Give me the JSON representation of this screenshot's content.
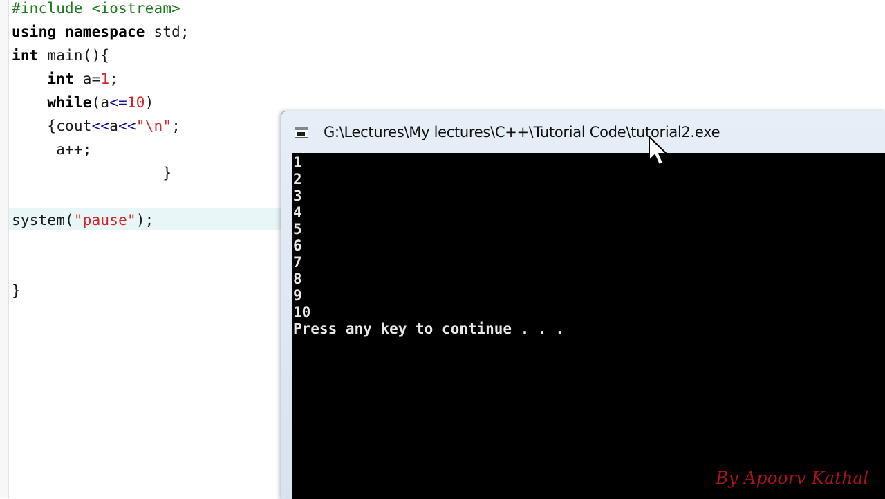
{
  "editor": {
    "lines": [
      [
        {
          "t": "#include <iostream>",
          "c": "pp"
        }
      ],
      [
        {
          "t": "using",
          "c": "kw"
        },
        {
          "t": " "
        },
        {
          "t": "namespace",
          "c": "kw"
        },
        {
          "t": " std;"
        }
      ],
      [
        {
          "t": "int",
          "c": "kw"
        },
        {
          "t": " main(){"
        }
      ],
      [
        {
          "t": "    "
        },
        {
          "t": "int",
          "c": "kw"
        },
        {
          "t": " a="
        },
        {
          "t": "1",
          "c": "num"
        },
        {
          "t": ";"
        }
      ],
      [
        {
          "t": "    "
        },
        {
          "t": "while",
          "c": "kw"
        },
        {
          "t": "(a"
        },
        {
          "t": "<=",
          "c": "op"
        },
        {
          "t": "10",
          "c": "num"
        },
        {
          "t": ")"
        }
      ],
      [
        {
          "t": "    {cout"
        },
        {
          "t": "<<",
          "c": "op"
        },
        {
          "t": "a"
        },
        {
          "t": "<<",
          "c": "op"
        },
        {
          "t": "\"\\n\"",
          "c": "str"
        },
        {
          "t": ";"
        }
      ],
      [
        {
          "t": "     a++;"
        }
      ],
      [
        {
          "t": "                 }"
        }
      ],
      [
        {
          "t": ""
        }
      ],
      [
        {
          "t": "system("
        },
        {
          "t": "\"pause\"",
          "c": "str"
        },
        {
          "t": ");"
        }
      ],
      [
        {
          "t": ""
        }
      ],
      [
        {
          "t": ""
        }
      ],
      [
        {
          "t": "}"
        }
      ]
    ]
  },
  "console": {
    "title": "G:\\Lectures\\My lectures\\C++\\Tutorial Code\\tutorial2.exe",
    "output": [
      "1",
      "2",
      "3",
      "4",
      "5",
      "6",
      "7",
      "8",
      "9",
      "10",
      "Press any key to continue . . ."
    ],
    "watermark": "By Apoorv Kathal"
  },
  "icons": {
    "app": "console-app-icon",
    "cursor": "arrow-cursor-icon"
  },
  "colors": {
    "console_bg": "#000000",
    "console_text": "#e8e8e8",
    "string_literal": "#d3222a",
    "preprocessor": "#1d7a1d",
    "line_highlight": "#e8f6f8",
    "watermark": "#a8141e"
  }
}
